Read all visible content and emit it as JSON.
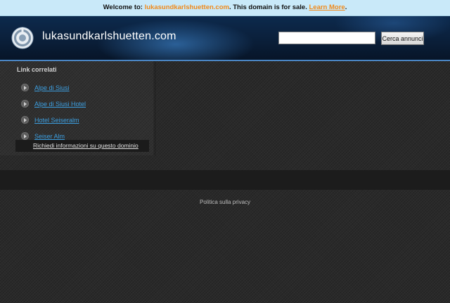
{
  "topbar": {
    "welcome_label": "Welcome to:",
    "domain": "lukasundkarlshuetten.com",
    "sale_text": ". This domain is for sale.",
    "learn_more": "Learn More",
    "trailing": "."
  },
  "header": {
    "site_title": "lukasundkarlshuetten.com",
    "logo_icon": "circular-logo-icon",
    "search": {
      "value": "",
      "placeholder": ""
    },
    "search_button": "Cerca annunci"
  },
  "sidebar": {
    "heading": "Link correlati",
    "items": [
      {
        "label": "Alpe di Siusi",
        "icon": "arrow-right-icon"
      },
      {
        "label": "Alpe di Siusi Hotel",
        "icon": "arrow-right-icon"
      },
      {
        "label": "Hotel Seiseralm",
        "icon": "arrow-right-icon"
      },
      {
        "label": "Seiser Alm",
        "icon": "arrow-right-icon"
      }
    ],
    "info_link": "Richiedi informazioni su questo dominio"
  },
  "footer": {
    "privacy": "Politica sulla privacy"
  },
  "colors": {
    "accent_orange": "#f08a1c",
    "link_blue": "#3d9fe0",
    "topbar_bg": "#c9e9f9"
  }
}
